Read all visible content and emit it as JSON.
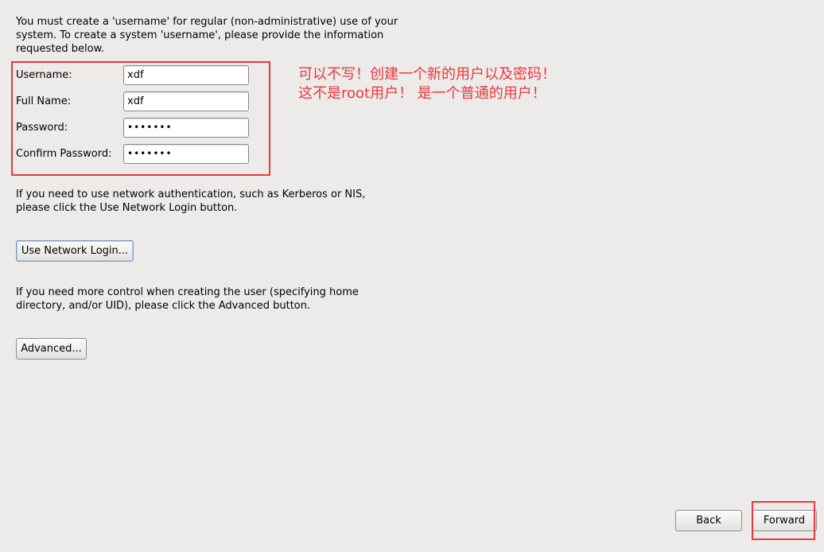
{
  "intro": {
    "text": "You must create a 'username' for regular (non-administrative) use of your\nsystem.  To create a system 'username', please provide the information\nrequested below."
  },
  "form": {
    "username": {
      "label": "Username:",
      "value": "xdf"
    },
    "full_name": {
      "label": "Full Name:",
      "value": "xdf"
    },
    "password": {
      "label": "Password:",
      "value": "•••••••"
    },
    "confirm_password": {
      "label": "Confirm Password:",
      "value": "•••••••"
    }
  },
  "annotation": {
    "line1": "可以不写！创建一个新的用户以及密码！",
    "line2": "这不是root用户！ 是一个普通的用户！",
    "color": "#e8383d"
  },
  "network": {
    "text": "If you need to use network authentication, such as Kerberos or NIS,\nplease click the Use Network Login button.",
    "button_label": "Use Network Login..."
  },
  "advanced": {
    "text": "If you need more control when creating the user (specifying home\ndirectory, and/or UID), please click the Advanced button.",
    "button_label": "Advanced..."
  },
  "nav": {
    "back_label": "Back",
    "forward_label": "Forward"
  }
}
